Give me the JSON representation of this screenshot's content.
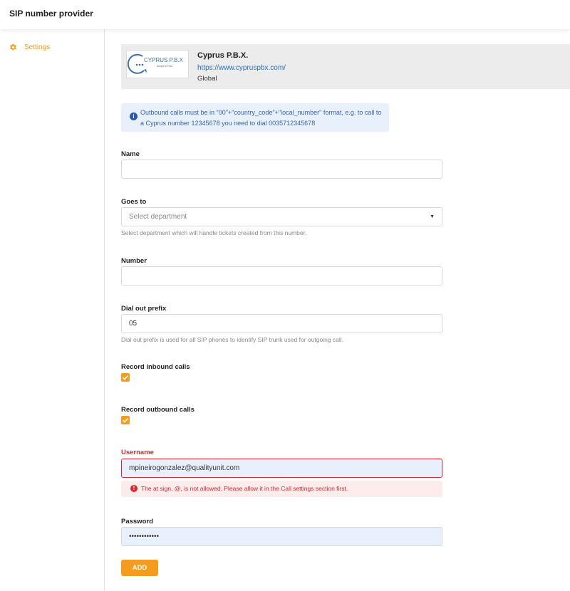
{
  "header": {
    "title": "SIP number provider"
  },
  "sidebar": {
    "items": [
      {
        "label": "Settings",
        "icon": "gear-icon"
      }
    ]
  },
  "provider": {
    "name": "Cyprus P.B.X.",
    "url": "https://www.cypruspbx.com/",
    "scope": "Global",
    "logo_text": "CYPRUS P.B.X",
    "logo_tagline": "Simple & Fast"
  },
  "info": {
    "text": "Outbound calls must be in \"00\"+\"country_code\"+\"local_number\" format, e.g. to call to a Cyprus number 12345678 you need to dial 0035712345678"
  },
  "form": {
    "name": {
      "label": "Name",
      "value": ""
    },
    "goes_to": {
      "label": "Goes to",
      "placeholder": "Select department",
      "help": "Select department which will handle tickets created from this number."
    },
    "number": {
      "label": "Number",
      "value": ""
    },
    "dial_out_prefix": {
      "label": "Dial out prefix",
      "value": "05",
      "help": "Dial out prefix is used for all SIP phones to identify SIP trunk used for outgoing call."
    },
    "record_inbound": {
      "label": "Record inbound calls",
      "checked": true
    },
    "record_outbound": {
      "label": "Record outbound calls",
      "checked": true
    },
    "username": {
      "label": "Username",
      "value": "mpineirogonzalez@qualityunit.com",
      "error": "The at sign, @, is not allowed. Please allow it in the Call settings section first."
    },
    "password": {
      "label": "Password",
      "value": "••••••••••••"
    },
    "add_label": "ADD"
  },
  "colors": {
    "accent": "#f39c1f",
    "error": "#d9282f",
    "info_bg": "#e8f0fb",
    "link": "#2a6fc9"
  }
}
